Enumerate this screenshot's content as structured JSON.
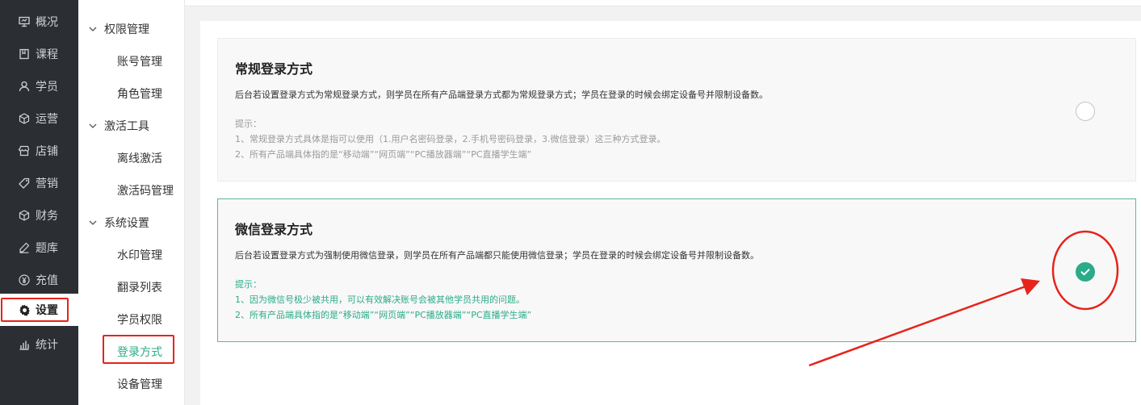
{
  "nav": {
    "items": [
      {
        "label": "概况",
        "icon": "presentation-icon"
      },
      {
        "label": "课程",
        "icon": "book-icon"
      },
      {
        "label": "学员",
        "icon": "user-icon"
      },
      {
        "label": "运营",
        "icon": "cube-icon"
      },
      {
        "label": "店铺",
        "icon": "store-icon"
      },
      {
        "label": "营销",
        "icon": "tag-icon"
      },
      {
        "label": "财务",
        "icon": "finance-cube-icon"
      },
      {
        "label": "题库",
        "icon": "pen-icon"
      },
      {
        "label": "充值",
        "icon": "yen-icon"
      },
      {
        "label": "设置",
        "icon": "gear-icon",
        "active": true
      },
      {
        "label": "统计",
        "icon": "bar-chart-icon"
      }
    ]
  },
  "submenu": {
    "groups": [
      {
        "label": "权限管理",
        "items": [
          "账号管理",
          "角色管理"
        ]
      },
      {
        "label": "激活工具",
        "items": [
          "离线激活",
          "激活码管理"
        ]
      },
      {
        "label": "系统设置",
        "items": [
          "水印管理",
          "翻录列表",
          "学员权限",
          "登录方式",
          "设备管理"
        ]
      }
    ],
    "active_item": "登录方式"
  },
  "options": {
    "normal": {
      "title": "常规登录方式",
      "desc": "后台若设置登录方式为常规登录方式，则学员在所有产品端登录方式都为常规登录方式；学员在登录的时候会绑定设备号并限制设备数。",
      "tip_title": "提示：",
      "tip_1": "1、常规登录方式具体是指可以使用（1.用户名密码登录，2.手机号密码登录，3.微信登录）这三种方式登录。",
      "tip_2": "2、所有产品端具体指的是“移动端”“网页端”“PC播放器端”“PC直播学生端”",
      "selected": false
    },
    "wechat": {
      "title": "微信登录方式",
      "desc": "后台若设置登录方式为强制使用微信登录，则学员在所有产品端都只能使用微信登录；学员在登录的时候会绑定设备号并限制设备数。",
      "tip_title": "提示：",
      "tip_1": "1、因为微信号极少被共用，可以有效解决账号会被其他学员共用的问题。",
      "tip_2": "2、所有产品端具体指的是“移动端”“网页端”“PC播放器端”“PC直播学生端”",
      "selected": true
    }
  },
  "colors": {
    "accent": "#2bab87",
    "nav_bg": "#2b2f33",
    "annotation_red": "#e6241b"
  }
}
